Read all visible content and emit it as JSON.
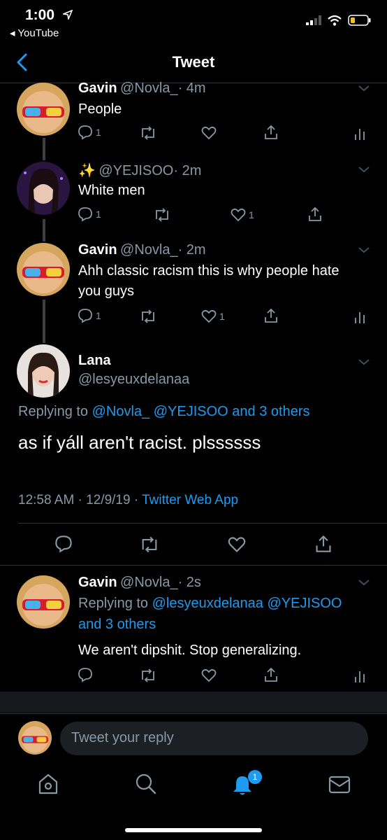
{
  "status": {
    "time": "1:00",
    "back_app": "◂ YouTube"
  },
  "nav": {
    "title": "Tweet"
  },
  "tweets": [
    {
      "name": "Gavin",
      "handle": "@Novla_",
      "time": "· 4m",
      "text": "People",
      "replies": "1",
      "likes": ""
    },
    {
      "name": "✨",
      "handle": "@YEJISOO",
      "time": "· 2m",
      "text": "White men",
      "replies": "1",
      "likes": "1"
    },
    {
      "name": "Gavin",
      "handle": "@Novla_",
      "time": "· 2m",
      "text_line1": "Ahh classic racism this is why people hate",
      "text_line2": "you guys",
      "replies": "1",
      "likes": "1"
    }
  ],
  "main_tweet": {
    "name": "Lana",
    "handle": "@lesyeuxdelanaa",
    "replying_prefix": "Replying to",
    "replying_to": "@Novla_ @YEJISOO and 3 others",
    "text": "as if yáll aren't racist. plssssss",
    "timestamp": "12:58 AM · 12/9/19 · ",
    "source": "Twitter Web App"
  },
  "reply_tweet": {
    "name": "Gavin",
    "handle": "@Novla_",
    "time": "· 2s",
    "replying_prefix": "Replying to",
    "replying_to_line1": "@lesyeuxdelanaa @YEJISOO",
    "replying_to_line2": "and 3 others",
    "text": "We aren't dipshit. Stop generalizing."
  },
  "composer": {
    "placeholder": "Tweet your reply"
  },
  "tabbar": {
    "notification_count": "1"
  },
  "colors": {
    "accent": "#1d9bf0",
    "muted": "#8899a6",
    "background": "#000000"
  }
}
